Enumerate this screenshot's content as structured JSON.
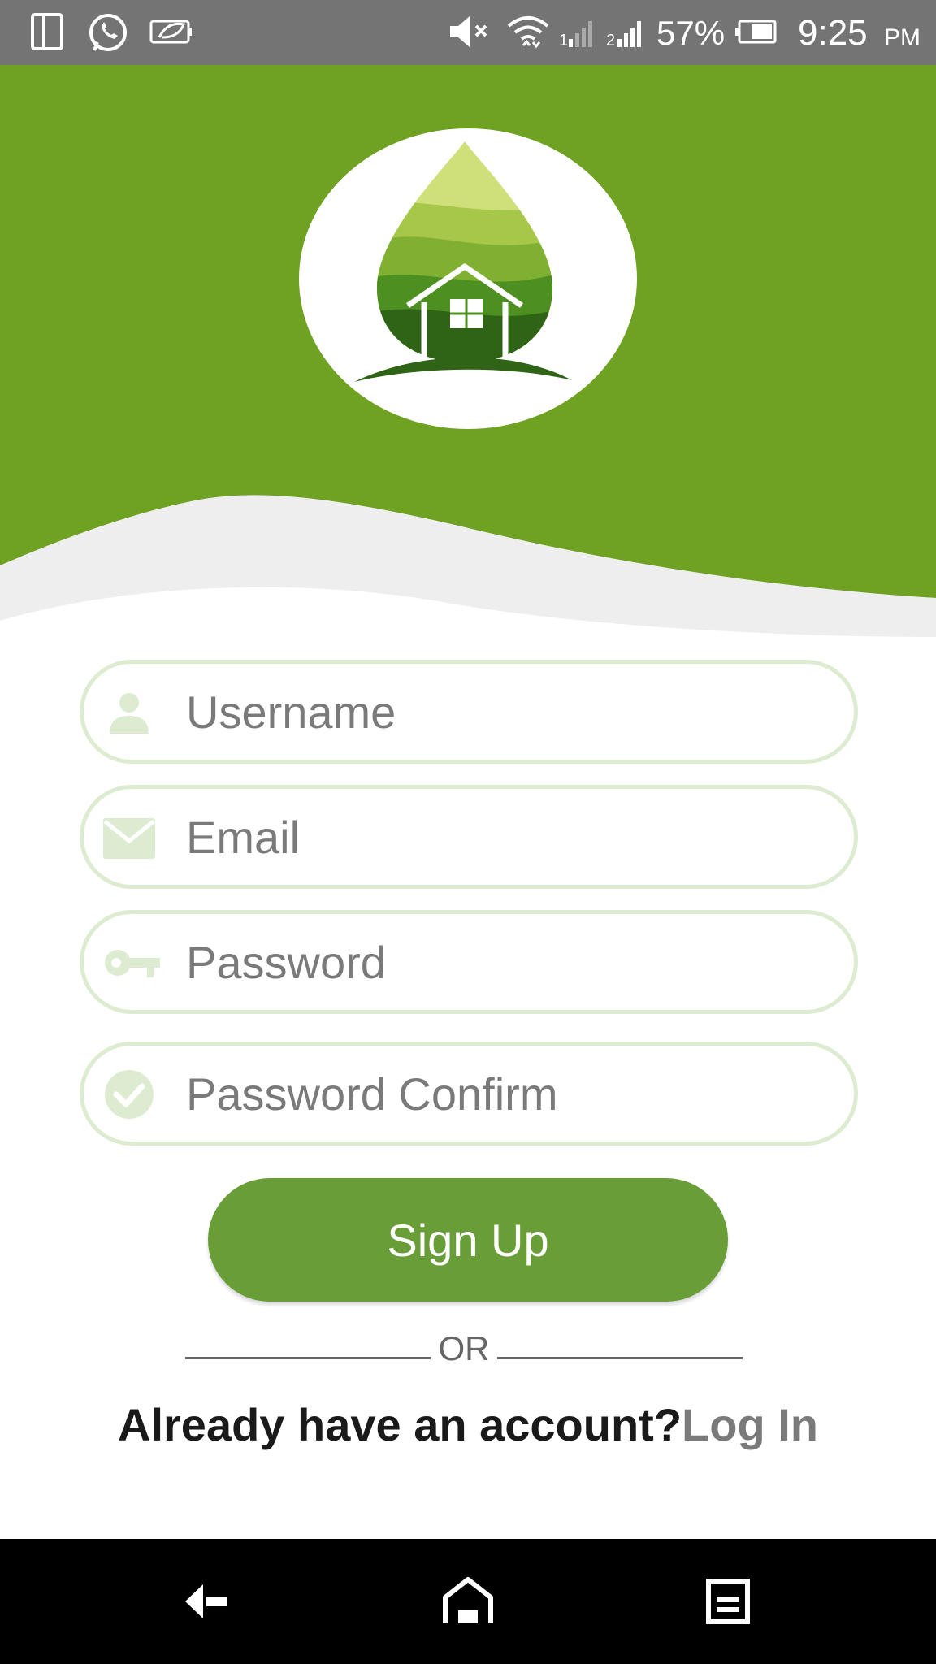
{
  "status_bar": {
    "battery_percent": "57%",
    "time": "9:25",
    "ampm": "PM",
    "icons": [
      "dual-screen-icon",
      "whatsapp-icon",
      "leaf-battery-icon",
      "mute-icon",
      "wifi-icon",
      "signal-1-icon",
      "signal-2-icon",
      "battery-icon"
    ]
  },
  "form": {
    "username": {
      "placeholder": "Username",
      "value": ""
    },
    "email": {
      "placeholder": "Email",
      "value": ""
    },
    "password": {
      "placeholder": "Password",
      "value": ""
    },
    "password_confirm": {
      "placeholder": "Password Confirm",
      "value": ""
    }
  },
  "actions": {
    "signup_label": "Sign Up",
    "or_label": "OR",
    "already_text": "Already have an account?",
    "login_label": "Log In"
  },
  "colors": {
    "brand_green": "#6fa122",
    "button_green": "#689d38",
    "field_border": "#ddecd0",
    "status_bar": "#747474"
  }
}
